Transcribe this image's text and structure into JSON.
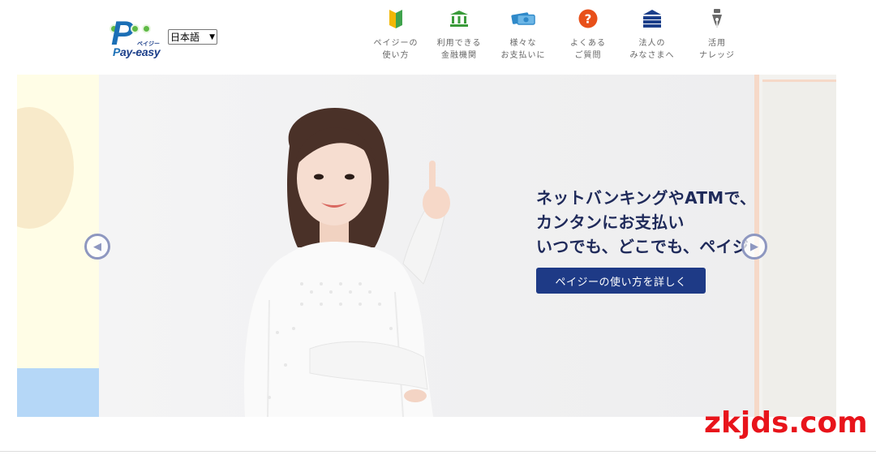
{
  "header": {
    "logo": {
      "text": "ay-easy",
      "kana": "ペイジー",
      "initial": "P"
    },
    "language_select": {
      "selected": "日本語"
    }
  },
  "nav": {
    "items": [
      {
        "label": "ペイジーの\n使い方",
        "icon": "beginner-mark-icon",
        "color": "#f2b705"
      },
      {
        "label": "利用できる\n金融機関",
        "icon": "bank-icon",
        "color": "#3a9b3a"
      },
      {
        "label": "様々な\nお支払いに",
        "icon": "money-payment-icon",
        "color": "#2f89c9"
      },
      {
        "label": "よくある\nご質問",
        "icon": "question-icon",
        "color": "#e8501a"
      },
      {
        "label": "法人の\nみなさまへ",
        "icon": "building-icon",
        "color": "#1c3f8a"
      },
      {
        "label": "活用\nナレッジ",
        "icon": "pen-nib-icon",
        "color": "#6a6a6a"
      }
    ]
  },
  "hero": {
    "headline": [
      "ネットバンキングやATMで、",
      "カンタンにお支払い",
      "いつでも、どこでも、ペイジー。"
    ],
    "cta_label": "ペイジーの使い方を詳しく",
    "prev_icon": "chevron-left-icon",
    "next_icon": "chevron-right-icon"
  },
  "watermark": {
    "text": "zkjds.com",
    "color": "#e8141b"
  },
  "colors": {
    "brand_blue": "#1c3f8a",
    "button_bg": "#1e3a86",
    "headline": "#1f2a5a"
  }
}
